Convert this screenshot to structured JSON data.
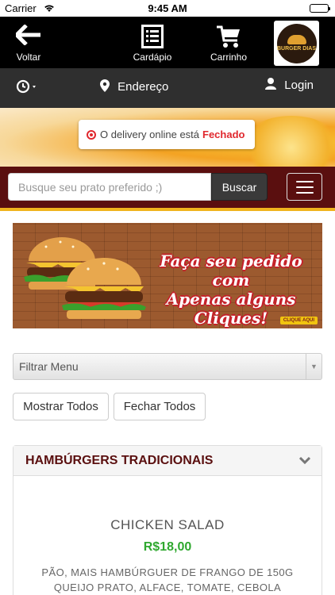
{
  "status_bar": {
    "carrier": "Carrier",
    "time": "9:45 AM"
  },
  "topnav": {
    "back_label": "Voltar",
    "menu_label": "Cardápio",
    "cart_label": "Carrinho",
    "logo_text": "BURGER DIAS"
  },
  "subnav": {
    "address_label": "Endereço",
    "login_label": "Login"
  },
  "delivery_status": {
    "text": "O delivery online está",
    "state": "Fechado"
  },
  "search": {
    "placeholder": "Busque seu prato preferido ;)",
    "button_label": "Buscar"
  },
  "banner": {
    "promo_line1": "Faça seu pedido com",
    "promo_line2": "Apenas alguns Cliques!",
    "cta": "CLIQUE AQUI"
  },
  "filter": {
    "selected": "Filtrar Menu"
  },
  "buttons": {
    "show_all": "Mostrar Todos",
    "close_all": "Fechar Todos"
  },
  "category": {
    "title": "HAMBÚRGERS TRADICIONAIS",
    "item": {
      "name": "CHICKEN SALAD",
      "price": "R$18,00",
      "desc_line1": "PÃO, MAIS HAMBÚRGUER DE FRANGO DE 150G",
      "desc_line2": "QUEIJO PRATO, ALFACE, TOMATE, CEBOLA"
    }
  },
  "colors": {
    "nav_bg": "#000000",
    "subnav_bg": "#2f2f2f",
    "search_bar_bg": "#5a0f0f",
    "accent_yellow": "#f0b41e",
    "closed_red": "#e0282e",
    "price_green": "#2fa82f"
  },
  "icons": [
    "wifi-icon",
    "battery-icon",
    "back-arrow-icon",
    "menu-list-icon",
    "cart-icon",
    "clock-icon",
    "location-pin-icon",
    "user-icon",
    "hamburger-menu-icon",
    "chevron-down-icon"
  ]
}
